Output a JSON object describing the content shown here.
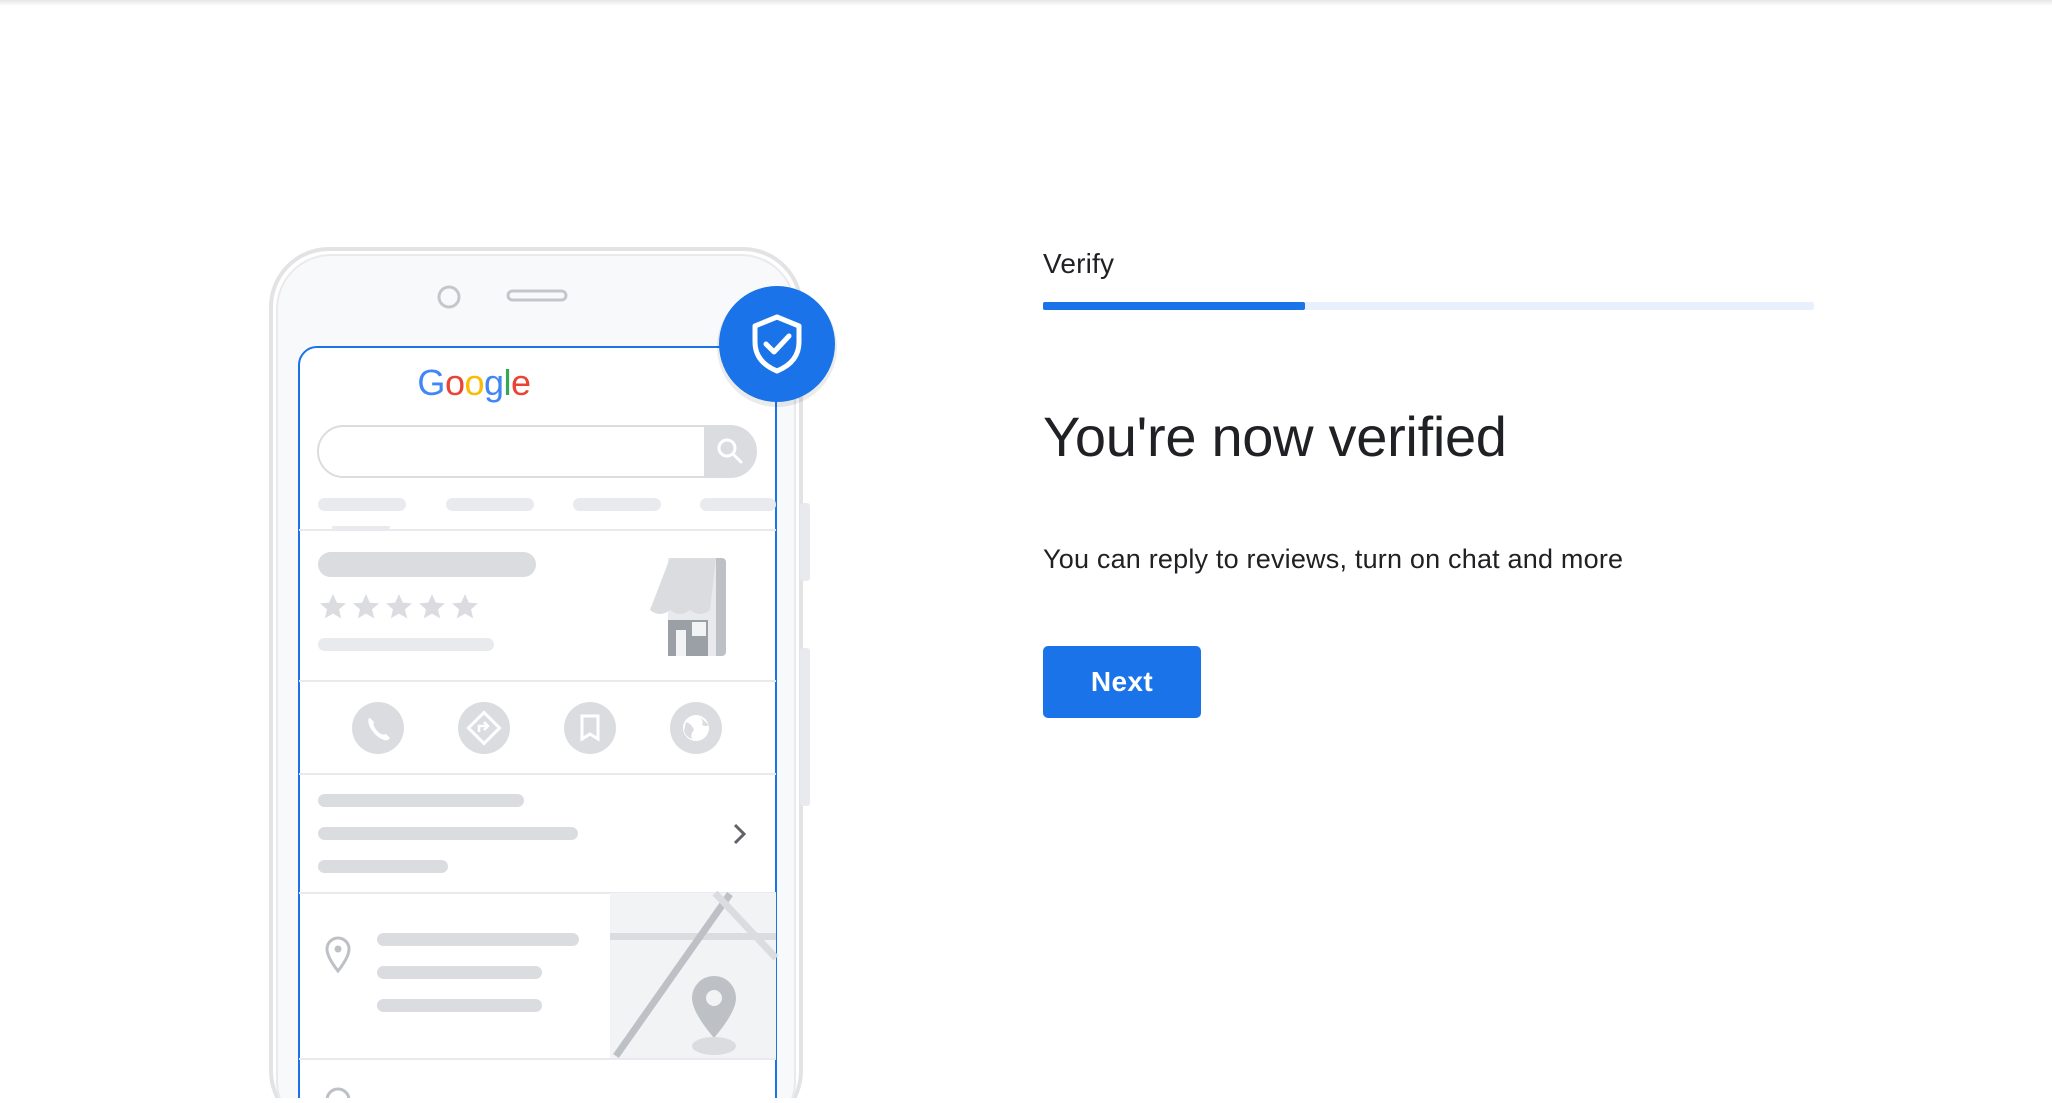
{
  "stepper": {
    "step_label": "Verify",
    "progress": 0.34
  },
  "content": {
    "headline": "You're now verified",
    "subtext": "You can reply to reviews, turn on chat and more",
    "next_label": "Next"
  },
  "illustration": {
    "brand_logo": "Google",
    "badge_icon": "shield-check-icon",
    "rating_stars": 5,
    "action_icons": [
      "phone-icon",
      "directions-icon",
      "bookmark-icon",
      "globe-icon"
    ]
  },
  "colors": {
    "accent": "#1a73e8",
    "progress_track": "#e8f0fe",
    "text_primary": "#202124",
    "placeholder_gray": "#dadce0",
    "icon_gray": "#bdc1c6"
  }
}
